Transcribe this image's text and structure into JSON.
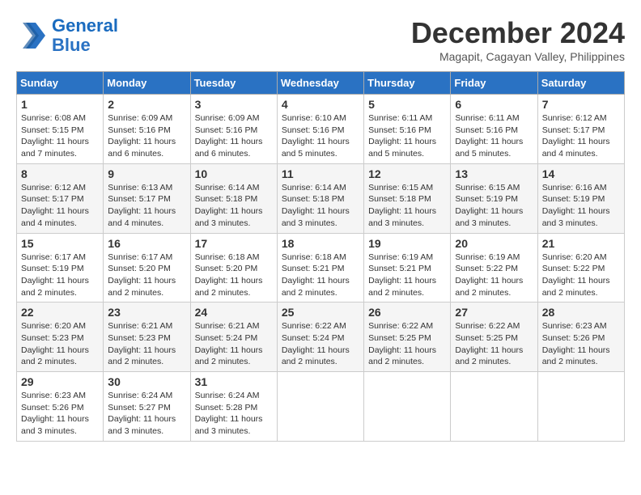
{
  "header": {
    "logo_line1": "General",
    "logo_line2": "Blue",
    "month_title": "December 2024",
    "location": "Magapit, Cagayan Valley, Philippines"
  },
  "weekdays": [
    "Sunday",
    "Monday",
    "Tuesday",
    "Wednesday",
    "Thursday",
    "Friday",
    "Saturday"
  ],
  "weeks": [
    [
      {
        "day": "1",
        "sunrise": "6:08 AM",
        "sunset": "5:15 PM",
        "daylight": "11 hours and 7 minutes."
      },
      {
        "day": "2",
        "sunrise": "6:09 AM",
        "sunset": "5:16 PM",
        "daylight": "11 hours and 6 minutes."
      },
      {
        "day": "3",
        "sunrise": "6:09 AM",
        "sunset": "5:16 PM",
        "daylight": "11 hours and 6 minutes."
      },
      {
        "day": "4",
        "sunrise": "6:10 AM",
        "sunset": "5:16 PM",
        "daylight": "11 hours and 5 minutes."
      },
      {
        "day": "5",
        "sunrise": "6:11 AM",
        "sunset": "5:16 PM",
        "daylight": "11 hours and 5 minutes."
      },
      {
        "day": "6",
        "sunrise": "6:11 AM",
        "sunset": "5:16 PM",
        "daylight": "11 hours and 5 minutes."
      },
      {
        "day": "7",
        "sunrise": "6:12 AM",
        "sunset": "5:17 PM",
        "daylight": "11 hours and 4 minutes."
      }
    ],
    [
      {
        "day": "8",
        "sunrise": "6:12 AM",
        "sunset": "5:17 PM",
        "daylight": "11 hours and 4 minutes."
      },
      {
        "day": "9",
        "sunrise": "6:13 AM",
        "sunset": "5:17 PM",
        "daylight": "11 hours and 4 minutes."
      },
      {
        "day": "10",
        "sunrise": "6:14 AM",
        "sunset": "5:18 PM",
        "daylight": "11 hours and 3 minutes."
      },
      {
        "day": "11",
        "sunrise": "6:14 AM",
        "sunset": "5:18 PM",
        "daylight": "11 hours and 3 minutes."
      },
      {
        "day": "12",
        "sunrise": "6:15 AM",
        "sunset": "5:18 PM",
        "daylight": "11 hours and 3 minutes."
      },
      {
        "day": "13",
        "sunrise": "6:15 AM",
        "sunset": "5:19 PM",
        "daylight": "11 hours and 3 minutes."
      },
      {
        "day": "14",
        "sunrise": "6:16 AM",
        "sunset": "5:19 PM",
        "daylight": "11 hours and 3 minutes."
      }
    ],
    [
      {
        "day": "15",
        "sunrise": "6:17 AM",
        "sunset": "5:19 PM",
        "daylight": "11 hours and 2 minutes."
      },
      {
        "day": "16",
        "sunrise": "6:17 AM",
        "sunset": "5:20 PM",
        "daylight": "11 hours and 2 minutes."
      },
      {
        "day": "17",
        "sunrise": "6:18 AM",
        "sunset": "5:20 PM",
        "daylight": "11 hours and 2 minutes."
      },
      {
        "day": "18",
        "sunrise": "6:18 AM",
        "sunset": "5:21 PM",
        "daylight": "11 hours and 2 minutes."
      },
      {
        "day": "19",
        "sunrise": "6:19 AM",
        "sunset": "5:21 PM",
        "daylight": "11 hours and 2 minutes."
      },
      {
        "day": "20",
        "sunrise": "6:19 AM",
        "sunset": "5:22 PM",
        "daylight": "11 hours and 2 minutes."
      },
      {
        "day": "21",
        "sunrise": "6:20 AM",
        "sunset": "5:22 PM",
        "daylight": "11 hours and 2 minutes."
      }
    ],
    [
      {
        "day": "22",
        "sunrise": "6:20 AM",
        "sunset": "5:23 PM",
        "daylight": "11 hours and 2 minutes."
      },
      {
        "day": "23",
        "sunrise": "6:21 AM",
        "sunset": "5:23 PM",
        "daylight": "11 hours and 2 minutes."
      },
      {
        "day": "24",
        "sunrise": "6:21 AM",
        "sunset": "5:24 PM",
        "daylight": "11 hours and 2 minutes."
      },
      {
        "day": "25",
        "sunrise": "6:22 AM",
        "sunset": "5:24 PM",
        "daylight": "11 hours and 2 minutes."
      },
      {
        "day": "26",
        "sunrise": "6:22 AM",
        "sunset": "5:25 PM",
        "daylight": "11 hours and 2 minutes."
      },
      {
        "day": "27",
        "sunrise": "6:22 AM",
        "sunset": "5:25 PM",
        "daylight": "11 hours and 2 minutes."
      },
      {
        "day": "28",
        "sunrise": "6:23 AM",
        "sunset": "5:26 PM",
        "daylight": "11 hours and 2 minutes."
      }
    ],
    [
      {
        "day": "29",
        "sunrise": "6:23 AM",
        "sunset": "5:26 PM",
        "daylight": "11 hours and 3 minutes."
      },
      {
        "day": "30",
        "sunrise": "6:24 AM",
        "sunset": "5:27 PM",
        "daylight": "11 hours and 3 minutes."
      },
      {
        "day": "31",
        "sunrise": "6:24 AM",
        "sunset": "5:28 PM",
        "daylight": "11 hours and 3 minutes."
      },
      null,
      null,
      null,
      null
    ]
  ]
}
